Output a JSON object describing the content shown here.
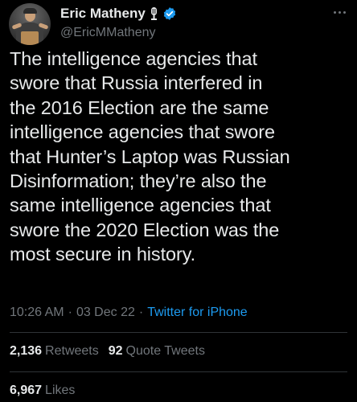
{
  "author": {
    "name": "Eric Matheny",
    "handle": "@EricMMatheny",
    "badges": [
      "microphone-icon",
      "verified-icon"
    ]
  },
  "tweet": {
    "text": "The intelligence agencies that\nswore that Russia interfered in\nthe 2016 Election are the same\nintelligence agencies that swore\nthat Hunter’s Laptop was Russian\nDisinformation; they’re also the\nsame intelligence agencies that\nswore the 2020 Election was the\nmost secure in history.",
    "time": "10:26 AM",
    "date": "03 Dec 22",
    "separator": "·",
    "source": "Twitter for iPhone"
  },
  "stats": {
    "retweets_count": "2,136",
    "retweets_label": "Retweets",
    "quotes_count": "92",
    "quotes_label": "Quote Tweets",
    "likes_count": "6,967",
    "likes_label": "Likes"
  },
  "colors": {
    "background": "#000000",
    "text": "#e7e9ea",
    "muted": "#71767b",
    "accent": "#1d9bf0",
    "divider": "#2f3336"
  }
}
